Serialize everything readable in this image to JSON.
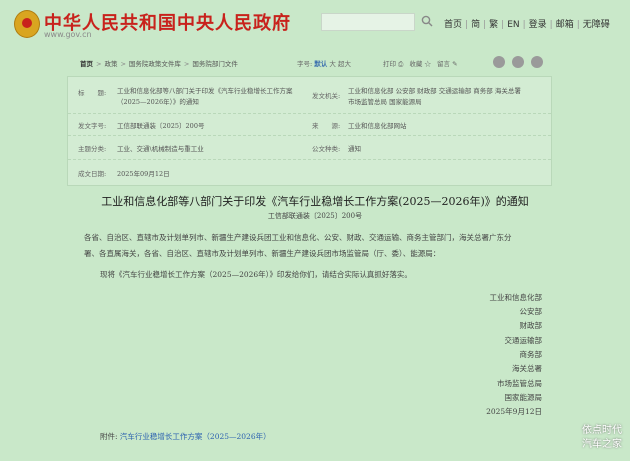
{
  "header": {
    "title": "中华人民共和国中央人民政府",
    "url": "www.gov.cn",
    "search": {
      "placeholder": ""
    },
    "nav": [
      "首页",
      "简",
      "繁",
      "EN",
      "登录",
      "邮箱",
      "无障碍"
    ]
  },
  "toolbar": {
    "breadcrumb": [
      "首页",
      "政策",
      "国务院政策文件库",
      "国务院部门文件"
    ],
    "font_label": "字号:",
    "font_sizes": [
      "默认",
      "大",
      "超大"
    ],
    "print": "打印",
    "favorite": "收藏",
    "message": "留言"
  },
  "meta": {
    "title_label": "标　　题:",
    "title_line1": "工业和信息化部等八部门关于印发《汽车行业稳增长工作方案",
    "title_line2": "（2025—2026年）》的通知",
    "issuer_label": "发文机关:",
    "issuer_line1": "工业和信息化部  公安部  财政部  交通运输部  商务部  海关总署",
    "issuer_line2": "市场监管总局  国家能源局",
    "docno_label": "发文字号:",
    "docno": "工信部联通装〔2025〕200号",
    "source_label": "来　　源:",
    "source": "工业和信息化部网站",
    "topic_label": "主题分类:",
    "topic": "工业、交通\\机械制造与重工业",
    "type_label": "公文种类:",
    "type": "通知",
    "date_label": "成文日期:",
    "date": "2025年09月12日"
  },
  "doc": {
    "title": "工业和信息化部等八部门关于印发《汽车行业稳增长工作方案(2025—2026年)》的通知",
    "number": "工信部联通装〔2025〕200号",
    "para1_line1": "各省、自治区、直辖市及计划单列市、新疆生产建设兵团工业和信息化、公安、财政、交通运输、商务主管部门，海关总署广东分",
    "para1_line2": "署、各直属海关，各省、自治区、直辖市及计划单列市、新疆生产建设兵团市场监管局（厅、委）、能源局：",
    "para2": "现将《汽车行业稳增长工作方案（2025—2026年）》印发给你们，请结合实际认真抓好落实。",
    "orgs": [
      "工业和信息化部",
      "公安部",
      "财政部",
      "交通运输部",
      "商务部",
      "海关总署",
      "市场监管总局",
      "国家能源局"
    ],
    "sign_date": "2025年9月12日",
    "attachment_label": "附件: ",
    "attachment_link": "汽车行业稳增长工作方案（2025—2026年）"
  },
  "watermark": {
    "line1": "依点时代",
    "line2": "汽车之家"
  }
}
